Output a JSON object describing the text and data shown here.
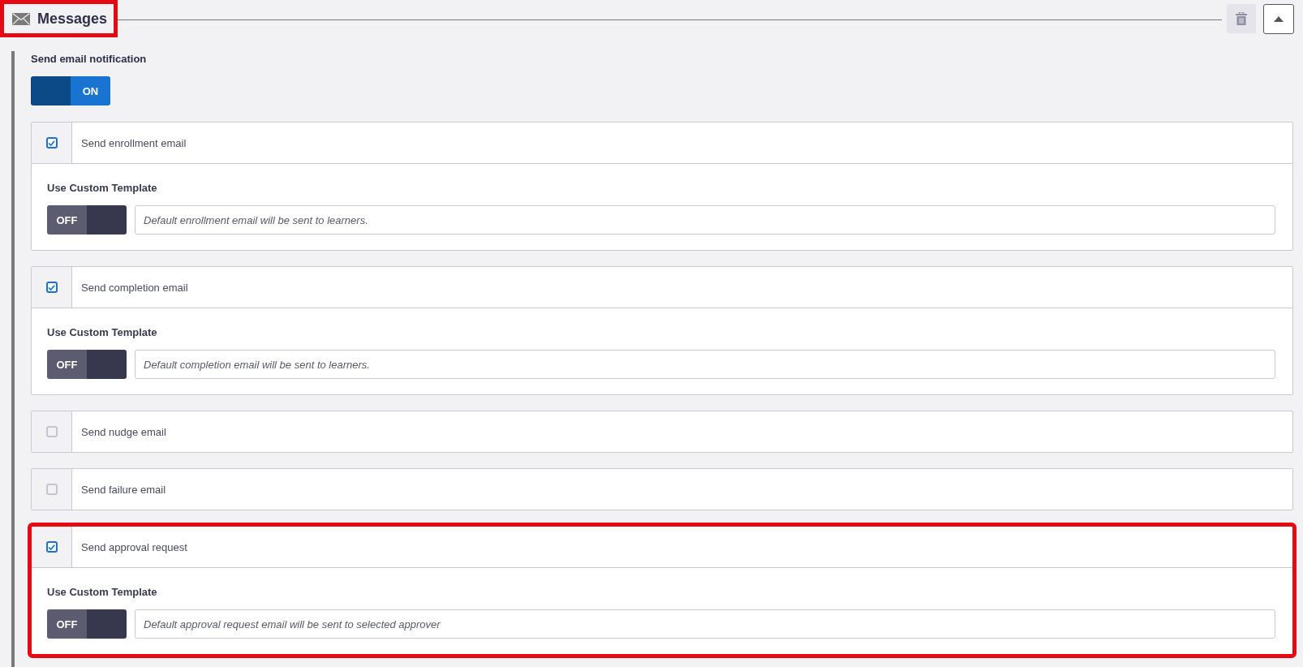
{
  "section": {
    "title": "Messages",
    "highlighted": true
  },
  "notification": {
    "label": "Send email notification",
    "toggle": {
      "text": "ON",
      "on": true
    }
  },
  "options": [
    {
      "label": "Send enrollment email",
      "checked": true,
      "highlighted": false,
      "template": {
        "label": "Use Custom Template",
        "toggle": {
          "text": "OFF",
          "on": false
        },
        "placeholder": "Default enrollment email will be sent to learners."
      }
    },
    {
      "label": "Send completion email",
      "checked": true,
      "highlighted": false,
      "template": {
        "label": "Use Custom Template",
        "toggle": {
          "text": "OFF",
          "on": false
        },
        "placeholder": "Default completion email will be sent to learners."
      }
    },
    {
      "label": "Send nudge email",
      "checked": false,
      "highlighted": false
    },
    {
      "label": "Send failure email",
      "checked": false,
      "highlighted": false
    },
    {
      "label": "Send approval request",
      "checked": true,
      "highlighted": true,
      "template": {
        "label": "Use Custom Template",
        "toggle": {
          "text": "OFF",
          "on": false
        },
        "placeholder": "Default approval request email will be sent to selected approver"
      }
    }
  ]
}
